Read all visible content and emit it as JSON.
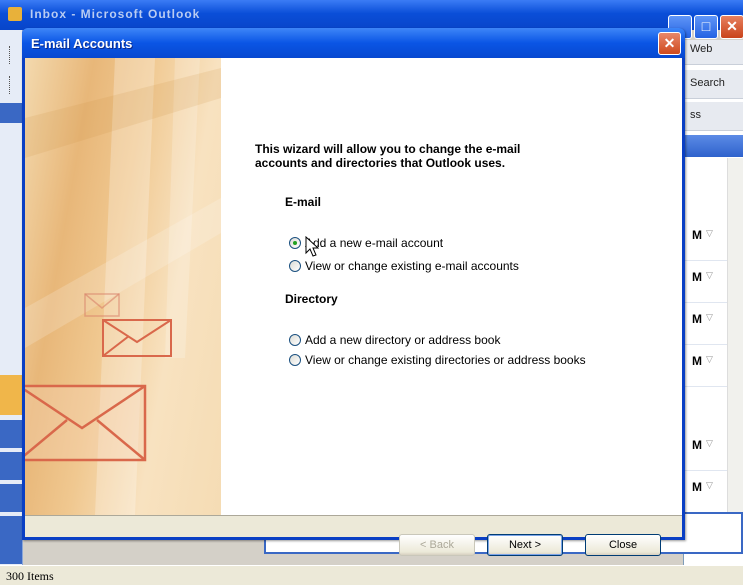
{
  "background_window": {
    "title": "Inbox - Microsoft Outlook",
    "right_pane": {
      "toolbar_text_1": "Web",
      "toolbar_text_2": "Search",
      "toolbar_text_3": "ss",
      "row_markers": [
        "M",
        "M",
        "M",
        "M",
        "M",
        "M"
      ]
    },
    "status_text": "300 Items"
  },
  "dialog": {
    "title": "E-mail Accounts",
    "close_glyph": "✕",
    "intro_text": "This wizard will allow you to change the e-mail accounts and directories that Outlook uses.",
    "email_section": {
      "heading": "E-mail",
      "options": [
        {
          "label": "Add a new e-mail account",
          "checked": true
        },
        {
          "label": "View or change existing e-mail accounts",
          "checked": false
        }
      ]
    },
    "directory_section": {
      "heading": "Directory",
      "options": [
        {
          "label": "Add a new directory or address book",
          "checked": false
        },
        {
          "label": "View or change existing directories or address books",
          "checked": false
        }
      ]
    },
    "buttons": {
      "back": "< Back",
      "next": "Next >",
      "close": "Close"
    }
  },
  "icons": {
    "cursor": "arrow-pointer-icon",
    "envelope": "envelope-icon"
  }
}
